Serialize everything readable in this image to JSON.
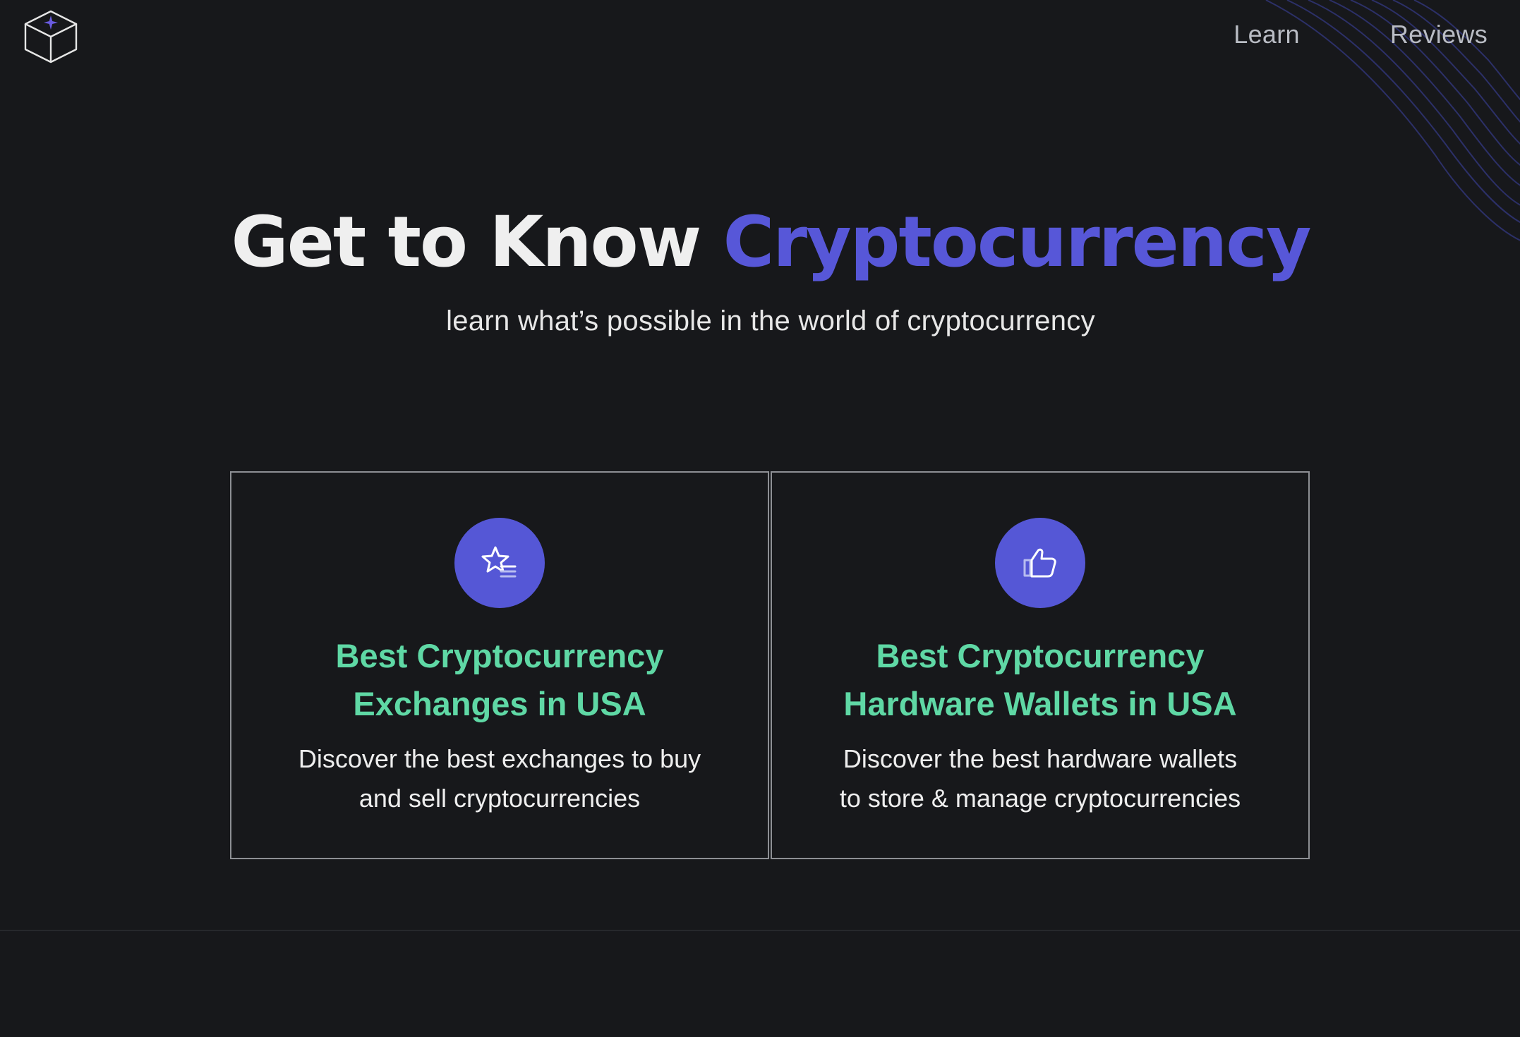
{
  "nav": {
    "learn": "Learn",
    "reviews": "Reviews"
  },
  "hero": {
    "title_plain": "Get to Know",
    "title_accent": "Cryptocurrency",
    "subtitle": "learn what’s possible in the world of cryptocurrency"
  },
  "cards": [
    {
      "icon": "star-list-icon",
      "title_line1": "Best Cryptocurrency",
      "title_line2": "Exchanges in USA",
      "desc_line1": "Discover the best exchanges to buy",
      "desc_line2": "and sell cryptocurrencies"
    },
    {
      "icon": "thumbs-up-icon",
      "title_line1": "Best Cryptocurrency",
      "title_line2": "Hardware Wallets in USA",
      "desc_line1": "Discover the best hardware wallets",
      "desc_line2": "to store & manage cryptocurrencies"
    }
  ],
  "colors": {
    "background": "#17181b",
    "accent": "#5757d8",
    "card_title": "#5fd8a5",
    "nav_text": "#b9bcc4"
  }
}
